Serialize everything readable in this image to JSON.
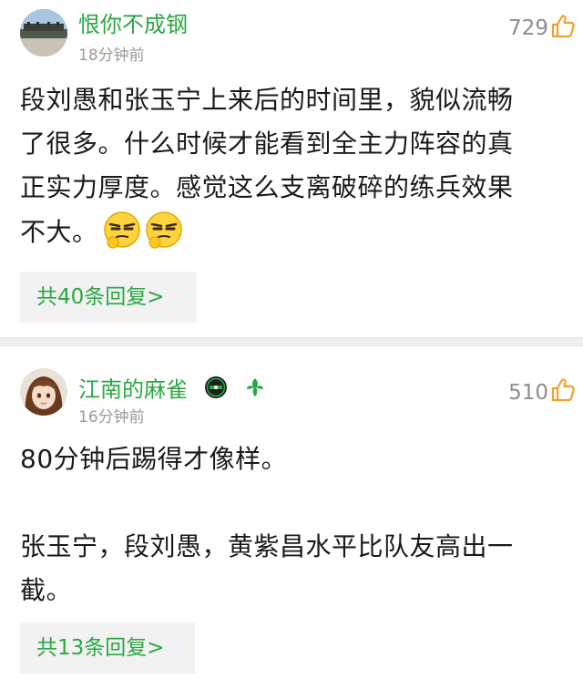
{
  "comments": [
    {
      "username": "恨你不成钢",
      "time": "18分钟前",
      "likes": "729",
      "lines": [
        "段刘愚和张玉宁上来后的时间里，貌似流畅",
        "了很多。什么时候才能看到全主力阵容的真",
        "正实力厚度。感觉这么支离破碎的练兵效果",
        "不大。"
      ],
      "emojis": [
        "smirk-thinking-emoji",
        "smirk-thinking-emoji"
      ],
      "reply_label": "共40条回复>"
    },
    {
      "username": "江南的麻雀",
      "time": "16分钟前",
      "likes": "510",
      "lines": [
        "80分钟后踢得才像样。",
        "",
        "张玉宁，段刘愚，黄紫昌水平比队友高出一",
        "截。"
      ],
      "badges": [
        "club-badge-icon",
        "fan-badge-icon"
      ],
      "reply_label": "共13条回复>"
    }
  ],
  "colors": {
    "accent_green": "#2aa843",
    "meta_gray": "#9a9a9a",
    "like_orange": "#f0a030",
    "text": "#1a1a1a"
  }
}
